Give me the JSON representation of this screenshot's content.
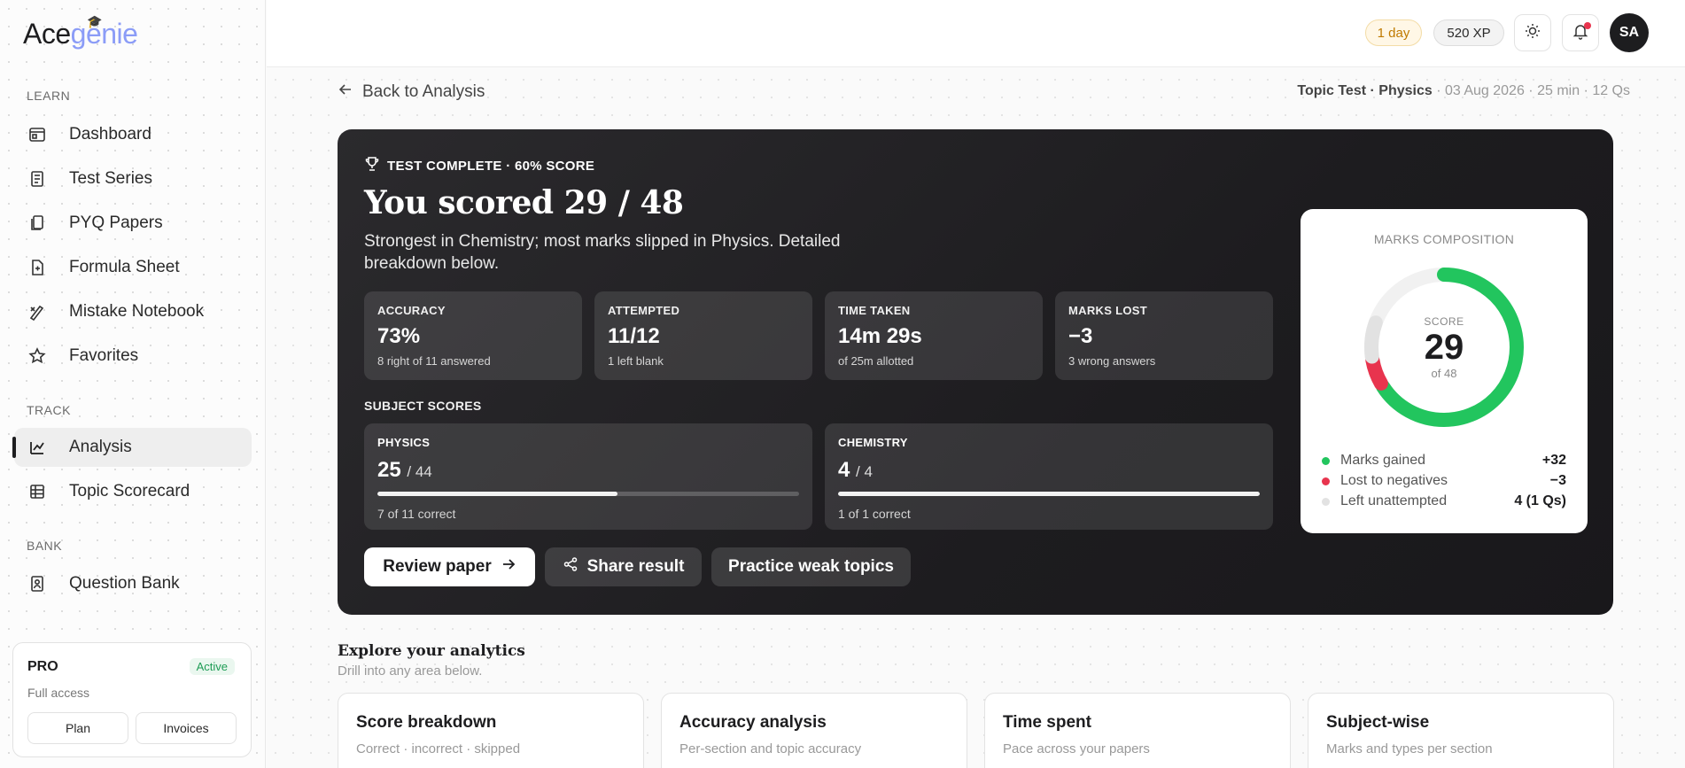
{
  "brand": {
    "logo_ace": "Ace",
    "logo_genie": "genie"
  },
  "sidebar": {
    "sections": {
      "learn": "LEARN",
      "track": "TRACK",
      "bank": "BANK"
    },
    "items": [
      {
        "label": "Dashboard",
        "icon": "dashboard-icon"
      },
      {
        "label": "Test Series",
        "icon": "test-series-icon"
      },
      {
        "label": "PYQ Papers",
        "icon": "papers-icon"
      },
      {
        "label": "Formula Sheet",
        "icon": "formula-icon"
      },
      {
        "label": "Mistake Notebook",
        "icon": "notebook-icon"
      },
      {
        "label": "Favorites",
        "icon": "star-icon"
      },
      {
        "label": "Analysis",
        "icon": "analysis-icon",
        "active": true
      },
      {
        "label": "Topic Scorecard",
        "icon": "scorecard-icon"
      },
      {
        "label": "Question Bank",
        "icon": "question-bank-icon"
      }
    ],
    "plan": {
      "title": "PRO",
      "status": "Active",
      "desc": "Full access",
      "plan_btn": "Plan",
      "invoices_btn": "Invoices"
    }
  },
  "topbar": {
    "streak": "1 day",
    "xp": "520 XP",
    "avatar": "SA",
    "has_notification": true
  },
  "page": {
    "back_label": "Back to Analysis",
    "meta_test": "Topic Test · Physics",
    "meta_details": " · 03 Aug 2026 · 25 min · 12 Qs"
  },
  "hero": {
    "kicker": "TEST COMPLETE · 60% SCORE",
    "headline": "You scored 29 / 48",
    "summary": "Strongest in Chemistry; most marks slipped in Physics. Detailed breakdown below.",
    "stats": [
      {
        "label": "ACCURACY",
        "value": "73%",
        "detail": "8 right of 11 answered"
      },
      {
        "label": "ATTEMPTED",
        "value": "11/12",
        "detail": "1 left blank"
      },
      {
        "label": "TIME TAKEN",
        "value": "14m 29s",
        "detail": "of 25m allotted"
      },
      {
        "label": "MARKS LOST",
        "value": "−3",
        "detail": "3 wrong answers"
      }
    ],
    "subject_heading": "SUBJECT SCORES",
    "subjects": [
      {
        "label": "PHYSICS",
        "score": "25",
        "total": "/ 44",
        "progress": 0.57,
        "detail": "7 of 11 correct"
      },
      {
        "label": "CHEMISTRY",
        "score": "4",
        "total": "/ 4",
        "progress": 1.0,
        "detail": "1 of 1 correct"
      }
    ],
    "actions": {
      "review": "Review paper",
      "share": "Share result",
      "practice": "Practice weak topics"
    }
  },
  "composition": {
    "title": "MARKS COMPOSITION",
    "center_label": "SCORE",
    "center_value": "29",
    "center_sub": "of 48",
    "segments": [
      {
        "label": "Marks gained",
        "value": "+32",
        "amount": 32,
        "color": "#22c55e"
      },
      {
        "label": "Lost to negatives",
        "value": "−3",
        "amount": 3,
        "color": "#e8344e"
      },
      {
        "label": "Left unattempted",
        "value": "4 (1 Qs)",
        "amount": 4,
        "color": "#e2e2e2"
      }
    ],
    "total": 48
  },
  "explore": {
    "heading": "Explore your analytics",
    "subheading": "Drill into any area below.",
    "cards": [
      {
        "title": "Score breakdown",
        "desc": "Correct · incorrect · skipped"
      },
      {
        "title": "Accuracy analysis",
        "desc": "Per-section and topic accuracy"
      },
      {
        "title": "Time spent",
        "desc": "Pace across your papers"
      },
      {
        "title": "Subject-wise",
        "desc": "Marks and types per section"
      }
    ]
  }
}
